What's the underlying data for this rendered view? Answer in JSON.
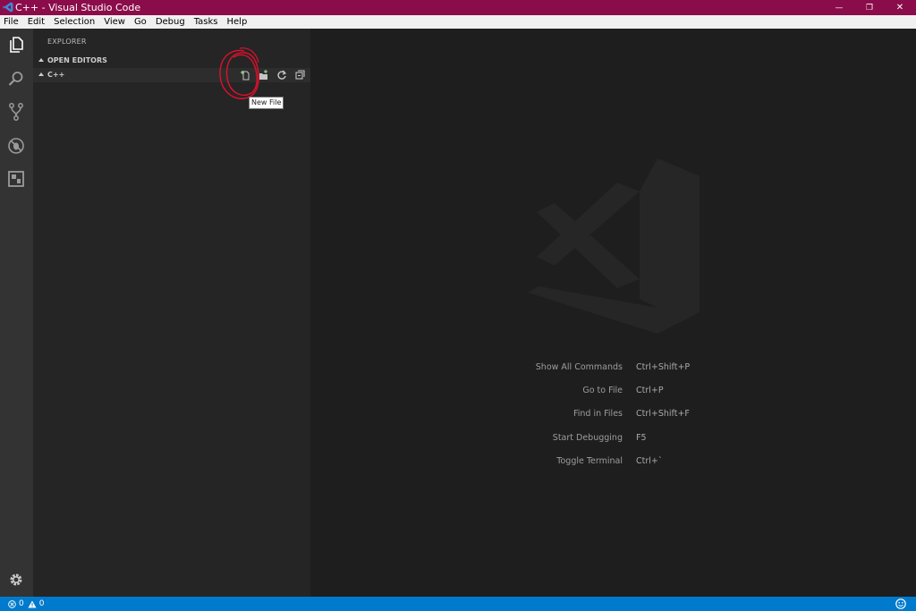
{
  "window": {
    "title": "C++ - Visual Studio Code",
    "minimize_glyph": "—",
    "restore_glyph": "❐",
    "close_glyph": "✕"
  },
  "menu": [
    "File",
    "Edit",
    "Selection",
    "View",
    "Go",
    "Debug",
    "Tasks",
    "Help"
  ],
  "activity_bar": {
    "icons": [
      "files-icon",
      "search-icon",
      "source-control-icon",
      "debug-icon",
      "extensions-icon"
    ],
    "bottom_icon": "gear-icon"
  },
  "sidebar": {
    "title": "EXPLORER",
    "open_editors_label": "OPEN EDITORS",
    "folder_label": "C++",
    "actions": [
      "new-file",
      "new-folder",
      "refresh",
      "collapse-all"
    ],
    "tooltip": "New File"
  },
  "editor": {
    "shortcuts": [
      {
        "command": "Show All Commands",
        "key": "Ctrl+Shift+P"
      },
      {
        "command": "Go to File",
        "key": "Ctrl+P"
      },
      {
        "command": "Find in Files",
        "key": "Ctrl+Shift+F"
      },
      {
        "command": "Start Debugging",
        "key": "F5"
      },
      {
        "command": "Toggle Terminal",
        "key": "Ctrl+`"
      }
    ]
  },
  "status_bar": {
    "errors": "0",
    "warnings": "0",
    "feedback_icon": "smiley-icon"
  },
  "colors": {
    "titlebar": "#8b0c4a",
    "statusbar": "#007acc",
    "activitybar": "#333333",
    "sidebar": "#252526",
    "editor": "#1e1e1e",
    "annotation": "#e0102a"
  }
}
